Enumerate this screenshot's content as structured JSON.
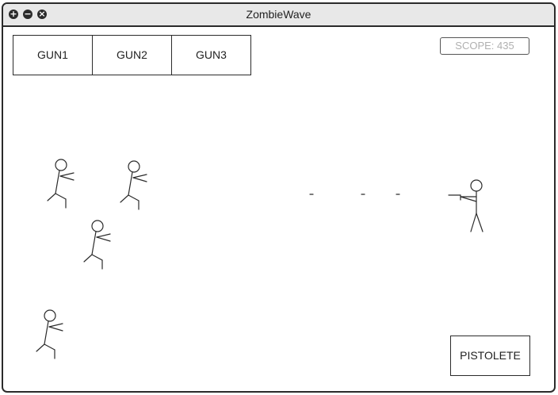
{
  "window": {
    "title": "ZombieWave"
  },
  "guns": [
    {
      "label": "GUN1"
    },
    {
      "label": "GUN2"
    },
    {
      "label": "GUN3"
    }
  ],
  "score": {
    "text": "SCOPE: 435"
  },
  "weapon": {
    "label": "PISTOLETE"
  },
  "icons": {
    "close": "close-icon",
    "minimize": "minimize-icon",
    "maximize": "maximize-icon",
    "zombie": "zombie-figure",
    "player": "player-figure",
    "bullet": "bullet"
  },
  "colors": {
    "stroke": "#2b2b2b",
    "titlebar": "#e8e8e8",
    "score_text": "#b0b0b0"
  }
}
